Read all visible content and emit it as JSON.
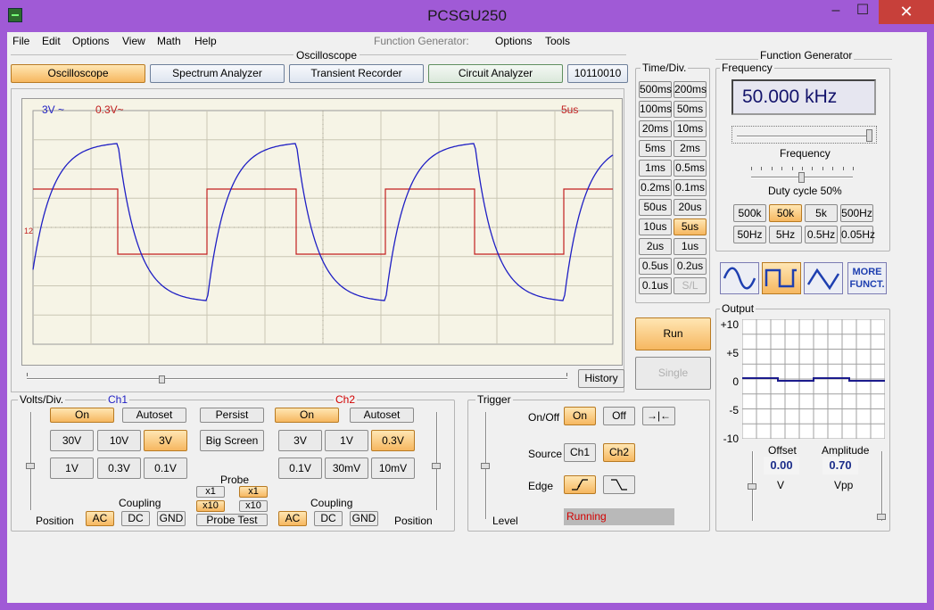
{
  "window": {
    "title": "PCSGU250",
    "minimize": "–",
    "maximize": "☐",
    "close": "✕"
  },
  "menu": {
    "file": "File",
    "edit": "Edit",
    "options": "Options",
    "view": "View",
    "math": "Math",
    "help": "Help",
    "fg_label": "Function Generator:",
    "fg_options": "Options",
    "fg_tools": "Tools"
  },
  "oscilloscope": {
    "section_title": "Oscilloscope",
    "tabs": [
      "Oscilloscope",
      "Spectrum Analyzer",
      "Transient Recorder",
      "Circuit Analyzer",
      "10110010"
    ],
    "screen": {
      "ch1_label": "3V ~",
      "ch2_label": "0.3V~",
      "timebase_label": "5us",
      "marker": "12"
    },
    "history_button": "History"
  },
  "timediv": {
    "title": "Time/Div.",
    "buttons": [
      [
        "500ms",
        "200ms"
      ],
      [
        "100ms",
        "50ms"
      ],
      [
        "20ms",
        "10ms"
      ],
      [
        "5ms",
        "2ms"
      ],
      [
        "1ms",
        "0.5ms"
      ],
      [
        "0.2ms",
        "0.1ms"
      ],
      [
        "50us",
        "20us"
      ],
      [
        "10us",
        "5us"
      ],
      [
        "2us",
        "1us"
      ],
      [
        "0.5us",
        "0.2us"
      ],
      [
        "0.1us",
        "S/L"
      ]
    ],
    "selected": "5us",
    "run": "Run",
    "single": "Single"
  },
  "volts": {
    "title": "Volts/Div.",
    "ch1": {
      "title": "Ch1",
      "on": "On",
      "autoset": "Autoset",
      "row1": [
        "30V",
        "10V",
        "3V"
      ],
      "row2": [
        "1V",
        "0.3V",
        "0.1V"
      ],
      "selected": "3V"
    },
    "ch2": {
      "title": "Ch2",
      "on": "On",
      "autoset": "Autoset",
      "row1": [
        "3V",
        "1V",
        "0.3V"
      ],
      "row2": [
        "0.1V",
        "30mV",
        "10mV"
      ],
      "selected": "0.3V"
    },
    "persist": "Persist",
    "big_screen": "Big Screen",
    "probe": {
      "title": "Probe",
      "x1": "x1",
      "x10": "x10",
      "test": "Probe Test"
    },
    "coupling": {
      "title": "Coupling",
      "ac": "AC",
      "dc": "DC",
      "gnd": "GND"
    },
    "position": "Position"
  },
  "trigger": {
    "title": "Trigger",
    "onoff_label": "On/Off",
    "on": "On",
    "off": "Off",
    "arrows": "→|←",
    "source_label": "Source",
    "ch1": "Ch1",
    "ch2": "Ch2",
    "edge_label": "Edge",
    "level_label": "Level",
    "status": "Running"
  },
  "function_generator": {
    "title": "Function Generator",
    "frequency_group": "Frequency",
    "frequency_value": "50.000 kHz",
    "frequency_slider_label": "Frequency",
    "duty_label": "Duty cycle 50%",
    "ranges": [
      [
        "500k",
        "50k",
        "5k",
        "500Hz"
      ],
      [
        "50Hz",
        "5Hz",
        "0.5Hz",
        "0.05Hz"
      ]
    ],
    "selected_range": "50k",
    "more": "MORE FUNCT.",
    "output_group": "Output",
    "output_axis": [
      "+10",
      "+5",
      "0",
      "-5",
      "-10"
    ],
    "offset_label": "Offset",
    "offset_value": "0.00",
    "offset_unit": "V",
    "amplitude_label": "Amplitude",
    "amplitude_value": "0.70",
    "amplitude_unit": "Vpp"
  },
  "colors": {
    "ch1_trace": "#1f1fc4",
    "ch2_trace": "#c21f1f",
    "accent_on": "#f6b760",
    "title_bar": "#a05ad6"
  }
}
